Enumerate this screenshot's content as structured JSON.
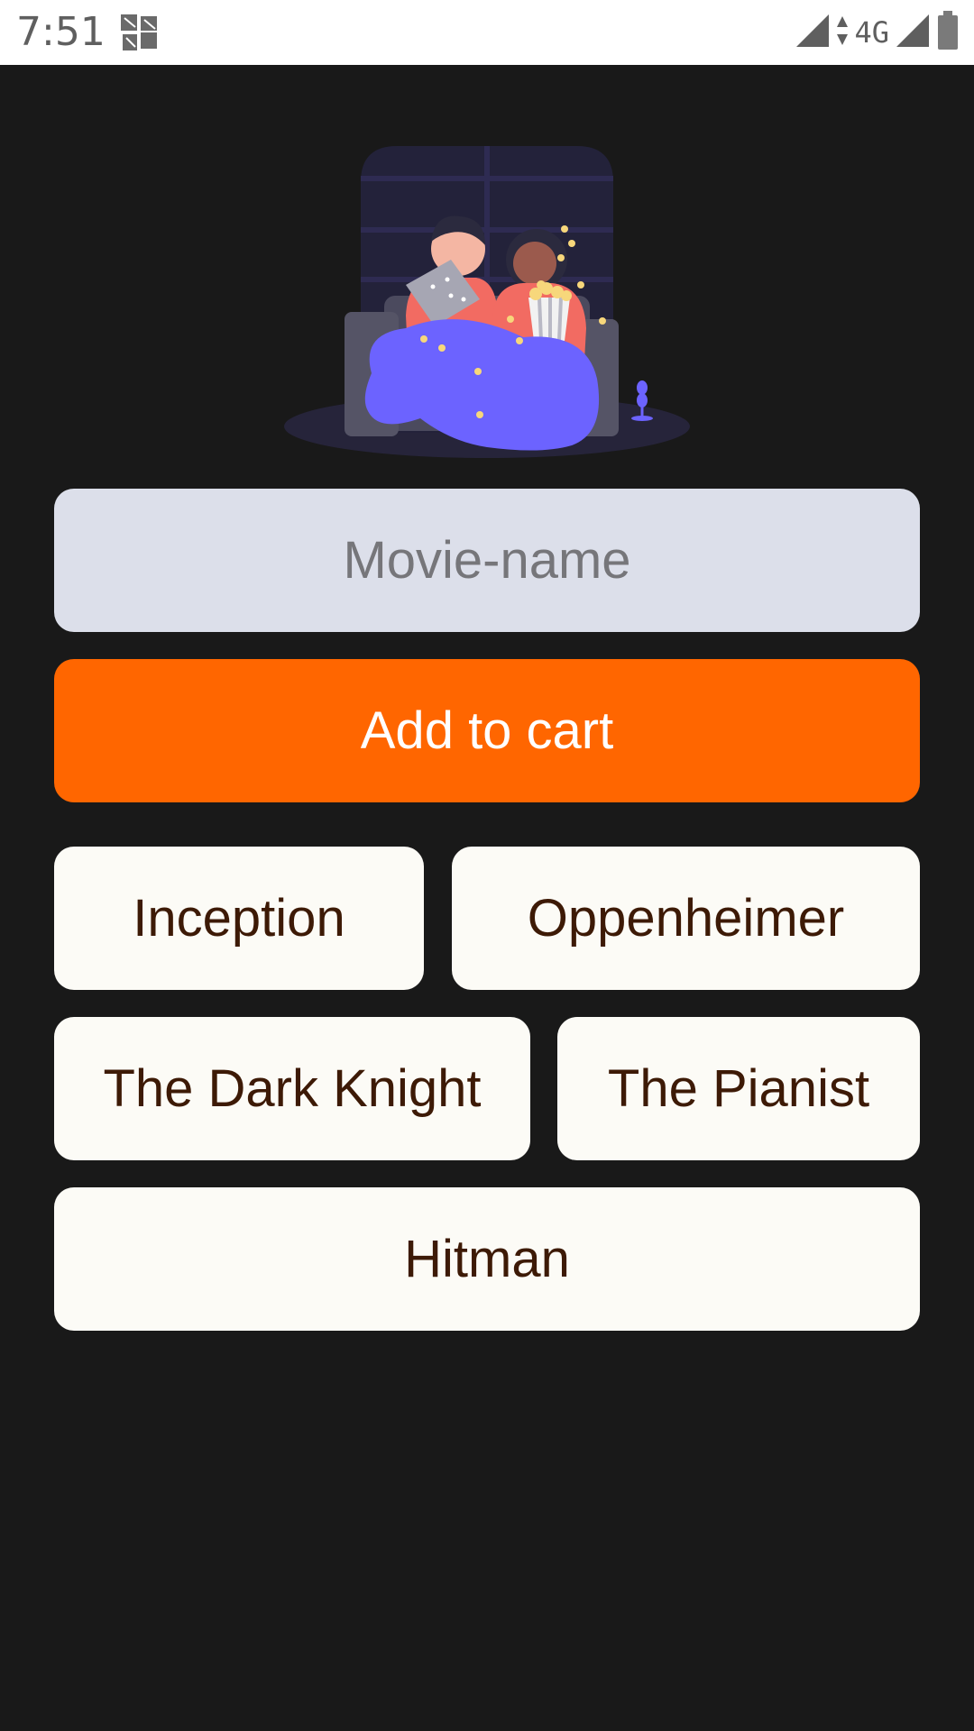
{
  "status_bar": {
    "time": "7:51",
    "network": "4G",
    "icons": [
      "app-notification-icon",
      "signal-icon",
      "data-arrows-icon",
      "signal-icon",
      "battery-icon"
    ]
  },
  "hero": {
    "illustration": "two-people-watching-movie-with-popcorn"
  },
  "movie_input": {
    "value": "",
    "placeholder": "Movie-name"
  },
  "add_button": {
    "label": "Add to cart",
    "color": "#ff6600"
  },
  "movies": [
    {
      "label": "Inception"
    },
    {
      "label": "Oppenheimer"
    },
    {
      "label": "The Dark Knight"
    },
    {
      "label": "The Pianist"
    },
    {
      "label": "Hitman"
    }
  ],
  "colors": {
    "background": "#191919",
    "input": "#dcdfea",
    "chip": "#fcfbf6",
    "chip_text": "#3d1a06",
    "accent": "#ff6600"
  }
}
